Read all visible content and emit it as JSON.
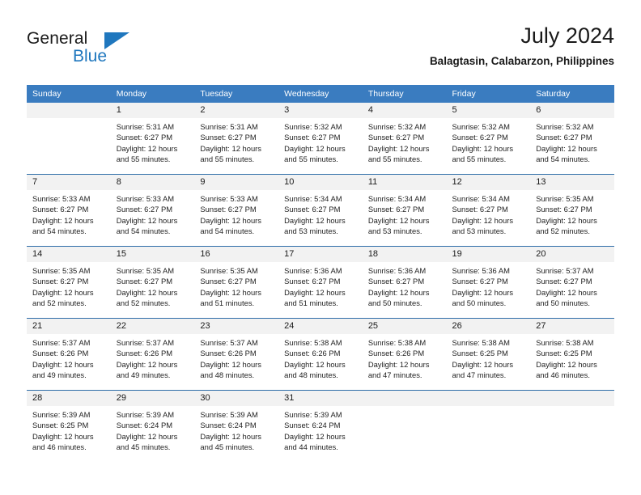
{
  "brand": {
    "name_part1": "General",
    "name_part2": "Blue",
    "triangle_color": "#1f77be"
  },
  "header": {
    "title": "July 2024",
    "subtitle": "Balagtasin, Calabarzon, Philippines"
  },
  "theme": {
    "header_blue": "#3a7cc0",
    "row_divider_blue": "#2e6da8",
    "daynum_background": "#f2f2f2"
  },
  "weekday_headers": [
    "Sunday",
    "Monday",
    "Tuesday",
    "Wednesday",
    "Thursday",
    "Friday",
    "Saturday"
  ],
  "weeks": [
    [
      {
        "day": "",
        "sunrise": "",
        "sunset": "",
        "daylight_line1": "",
        "daylight_line2": ""
      },
      {
        "day": "1",
        "sunrise": "Sunrise: 5:31 AM",
        "sunset": "Sunset: 6:27 PM",
        "daylight_line1": "Daylight: 12 hours",
        "daylight_line2": "and 55 minutes."
      },
      {
        "day": "2",
        "sunrise": "Sunrise: 5:31 AM",
        "sunset": "Sunset: 6:27 PM",
        "daylight_line1": "Daylight: 12 hours",
        "daylight_line2": "and 55 minutes."
      },
      {
        "day": "3",
        "sunrise": "Sunrise: 5:32 AM",
        "sunset": "Sunset: 6:27 PM",
        "daylight_line1": "Daylight: 12 hours",
        "daylight_line2": "and 55 minutes."
      },
      {
        "day": "4",
        "sunrise": "Sunrise: 5:32 AM",
        "sunset": "Sunset: 6:27 PM",
        "daylight_line1": "Daylight: 12 hours",
        "daylight_line2": "and 55 minutes."
      },
      {
        "day": "5",
        "sunrise": "Sunrise: 5:32 AM",
        "sunset": "Sunset: 6:27 PM",
        "daylight_line1": "Daylight: 12 hours",
        "daylight_line2": "and 55 minutes."
      },
      {
        "day": "6",
        "sunrise": "Sunrise: 5:32 AM",
        "sunset": "Sunset: 6:27 PM",
        "daylight_line1": "Daylight: 12 hours",
        "daylight_line2": "and 54 minutes."
      }
    ],
    [
      {
        "day": "7",
        "sunrise": "Sunrise: 5:33 AM",
        "sunset": "Sunset: 6:27 PM",
        "daylight_line1": "Daylight: 12 hours",
        "daylight_line2": "and 54 minutes."
      },
      {
        "day": "8",
        "sunrise": "Sunrise: 5:33 AM",
        "sunset": "Sunset: 6:27 PM",
        "daylight_line1": "Daylight: 12 hours",
        "daylight_line2": "and 54 minutes."
      },
      {
        "day": "9",
        "sunrise": "Sunrise: 5:33 AM",
        "sunset": "Sunset: 6:27 PM",
        "daylight_line1": "Daylight: 12 hours",
        "daylight_line2": "and 54 minutes."
      },
      {
        "day": "10",
        "sunrise": "Sunrise: 5:34 AM",
        "sunset": "Sunset: 6:27 PM",
        "daylight_line1": "Daylight: 12 hours",
        "daylight_line2": "and 53 minutes."
      },
      {
        "day": "11",
        "sunrise": "Sunrise: 5:34 AM",
        "sunset": "Sunset: 6:27 PM",
        "daylight_line1": "Daylight: 12 hours",
        "daylight_line2": "and 53 minutes."
      },
      {
        "day": "12",
        "sunrise": "Sunrise: 5:34 AM",
        "sunset": "Sunset: 6:27 PM",
        "daylight_line1": "Daylight: 12 hours",
        "daylight_line2": "and 53 minutes."
      },
      {
        "day": "13",
        "sunrise": "Sunrise: 5:35 AM",
        "sunset": "Sunset: 6:27 PM",
        "daylight_line1": "Daylight: 12 hours",
        "daylight_line2": "and 52 minutes."
      }
    ],
    [
      {
        "day": "14",
        "sunrise": "Sunrise: 5:35 AM",
        "sunset": "Sunset: 6:27 PM",
        "daylight_line1": "Daylight: 12 hours",
        "daylight_line2": "and 52 minutes."
      },
      {
        "day": "15",
        "sunrise": "Sunrise: 5:35 AM",
        "sunset": "Sunset: 6:27 PM",
        "daylight_line1": "Daylight: 12 hours",
        "daylight_line2": "and 52 minutes."
      },
      {
        "day": "16",
        "sunrise": "Sunrise: 5:35 AM",
        "sunset": "Sunset: 6:27 PM",
        "daylight_line1": "Daylight: 12 hours",
        "daylight_line2": "and 51 minutes."
      },
      {
        "day": "17",
        "sunrise": "Sunrise: 5:36 AM",
        "sunset": "Sunset: 6:27 PM",
        "daylight_line1": "Daylight: 12 hours",
        "daylight_line2": "and 51 minutes."
      },
      {
        "day": "18",
        "sunrise": "Sunrise: 5:36 AM",
        "sunset": "Sunset: 6:27 PM",
        "daylight_line1": "Daylight: 12 hours",
        "daylight_line2": "and 50 minutes."
      },
      {
        "day": "19",
        "sunrise": "Sunrise: 5:36 AM",
        "sunset": "Sunset: 6:27 PM",
        "daylight_line1": "Daylight: 12 hours",
        "daylight_line2": "and 50 minutes."
      },
      {
        "day": "20",
        "sunrise": "Sunrise: 5:37 AM",
        "sunset": "Sunset: 6:27 PM",
        "daylight_line1": "Daylight: 12 hours",
        "daylight_line2": "and 50 minutes."
      }
    ],
    [
      {
        "day": "21",
        "sunrise": "Sunrise: 5:37 AM",
        "sunset": "Sunset: 6:26 PM",
        "daylight_line1": "Daylight: 12 hours",
        "daylight_line2": "and 49 minutes."
      },
      {
        "day": "22",
        "sunrise": "Sunrise: 5:37 AM",
        "sunset": "Sunset: 6:26 PM",
        "daylight_line1": "Daylight: 12 hours",
        "daylight_line2": "and 49 minutes."
      },
      {
        "day": "23",
        "sunrise": "Sunrise: 5:37 AM",
        "sunset": "Sunset: 6:26 PM",
        "daylight_line1": "Daylight: 12 hours",
        "daylight_line2": "and 48 minutes."
      },
      {
        "day": "24",
        "sunrise": "Sunrise: 5:38 AM",
        "sunset": "Sunset: 6:26 PM",
        "daylight_line1": "Daylight: 12 hours",
        "daylight_line2": "and 48 minutes."
      },
      {
        "day": "25",
        "sunrise": "Sunrise: 5:38 AM",
        "sunset": "Sunset: 6:26 PM",
        "daylight_line1": "Daylight: 12 hours",
        "daylight_line2": "and 47 minutes."
      },
      {
        "day": "26",
        "sunrise": "Sunrise: 5:38 AM",
        "sunset": "Sunset: 6:25 PM",
        "daylight_line1": "Daylight: 12 hours",
        "daylight_line2": "and 47 minutes."
      },
      {
        "day": "27",
        "sunrise": "Sunrise: 5:38 AM",
        "sunset": "Sunset: 6:25 PM",
        "daylight_line1": "Daylight: 12 hours",
        "daylight_line2": "and 46 minutes."
      }
    ],
    [
      {
        "day": "28",
        "sunrise": "Sunrise: 5:39 AM",
        "sunset": "Sunset: 6:25 PM",
        "daylight_line1": "Daylight: 12 hours",
        "daylight_line2": "and 46 minutes."
      },
      {
        "day": "29",
        "sunrise": "Sunrise: 5:39 AM",
        "sunset": "Sunset: 6:24 PM",
        "daylight_line1": "Daylight: 12 hours",
        "daylight_line2": "and 45 minutes."
      },
      {
        "day": "30",
        "sunrise": "Sunrise: 5:39 AM",
        "sunset": "Sunset: 6:24 PM",
        "daylight_line1": "Daylight: 12 hours",
        "daylight_line2": "and 45 minutes."
      },
      {
        "day": "31",
        "sunrise": "Sunrise: 5:39 AM",
        "sunset": "Sunset: 6:24 PM",
        "daylight_line1": "Daylight: 12 hours",
        "daylight_line2": "and 44 minutes."
      },
      {
        "day": "",
        "sunrise": "",
        "sunset": "",
        "daylight_line1": "",
        "daylight_line2": ""
      },
      {
        "day": "",
        "sunrise": "",
        "sunset": "",
        "daylight_line1": "",
        "daylight_line2": ""
      },
      {
        "day": "",
        "sunrise": "",
        "sunset": "",
        "daylight_line1": "",
        "daylight_line2": ""
      }
    ]
  ]
}
